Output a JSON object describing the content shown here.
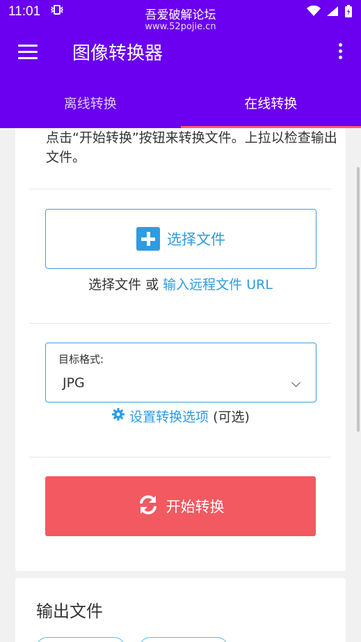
{
  "status_bar": {
    "time": "11:01",
    "title": "吾爱破解论坛",
    "url": "www.52pojie.cn"
  },
  "app_bar": {
    "title": "图像转换器"
  },
  "tabs": [
    {
      "label": "离线转换",
      "active": false
    },
    {
      "label": "在线转换",
      "active": true
    }
  ],
  "main": {
    "intro_text": "点击“开始转换”按钮来转换文件。上拉以检查输出文件。",
    "choose_file_label": "选择文件",
    "or_prefix": "选择文件 或 ",
    "remote_link": "输入远程文件 URL",
    "format_label": "目标格式:",
    "format_value": "JPG",
    "options_link": "设置转换选项",
    "options_suffix": "(可选)",
    "convert_label": "开始转换"
  },
  "output": {
    "title": "输出文件"
  },
  "colors": {
    "primary": "#6a00ef",
    "accent_link": "#2f9be2",
    "convert_button": "#f25961",
    "tab_indicator": "#ff5a6e"
  }
}
